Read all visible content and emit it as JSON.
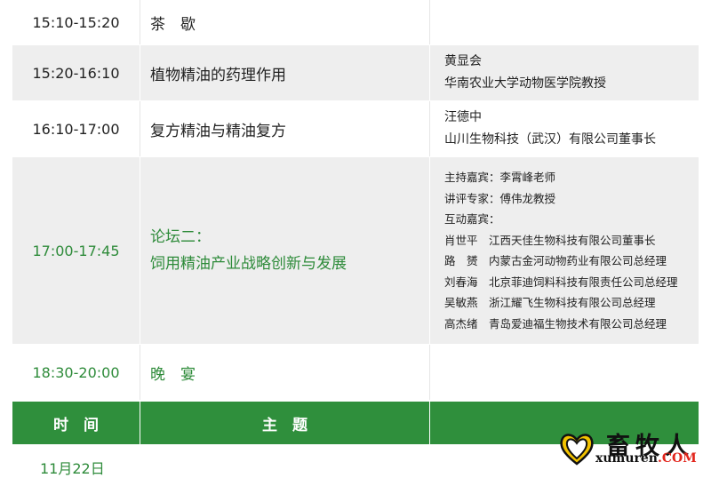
{
  "schedule": [
    {
      "time": "15:10-15:20",
      "topic": "茶　歇",
      "speaker_name": "",
      "speaker_title": ""
    },
    {
      "time": "15:20-16:10",
      "topic": "植物精油的药理作用",
      "speaker_name": "黄显会",
      "speaker_title": "华南农业大学动物医学院教授"
    },
    {
      "time": "16:10-17:00",
      "topic": "复方精油与精油复方",
      "speaker_name": "汪德中",
      "speaker_title": "山川生物科技（武汉）有限公司董事长"
    }
  ],
  "forum": {
    "time": "17:00-17:45",
    "title_line1": "论坛二：",
    "title_line2": "饲用精油产业战略创新与发展",
    "lines": [
      "主持嘉宾：李霄峰老师",
      "讲评专家：傅伟龙教授",
      "互动嘉宾：",
      "肖世平　江西天佳生物科技有限公司董事长",
      "路　赟　内蒙古金河动物药业有限公司总经理",
      "刘春海　北京菲迪饲料科技有限责任公司总经理",
      "吴敏燕　浙江耀飞生物科技有限公司总经理",
      "高杰绪　青岛爱迪福生物技术有限公司总经理"
    ]
  },
  "dinner": {
    "time": "18:30-20:00",
    "topic": "晚　宴"
  },
  "header": {
    "time_label": "时　间",
    "topic_label": "主　题",
    "speaker_label": ""
  },
  "next_date": "11月22日",
  "logo": {
    "cn": "畜牧人",
    "en_main": "xumuren",
    "en_suffix": ".COM"
  },
  "colors": {
    "accent_green": "#2e8b3a",
    "header_green": "#2f8f3c",
    "row_grey": "#eeeeee",
    "logo_red": "#e2231a"
  }
}
